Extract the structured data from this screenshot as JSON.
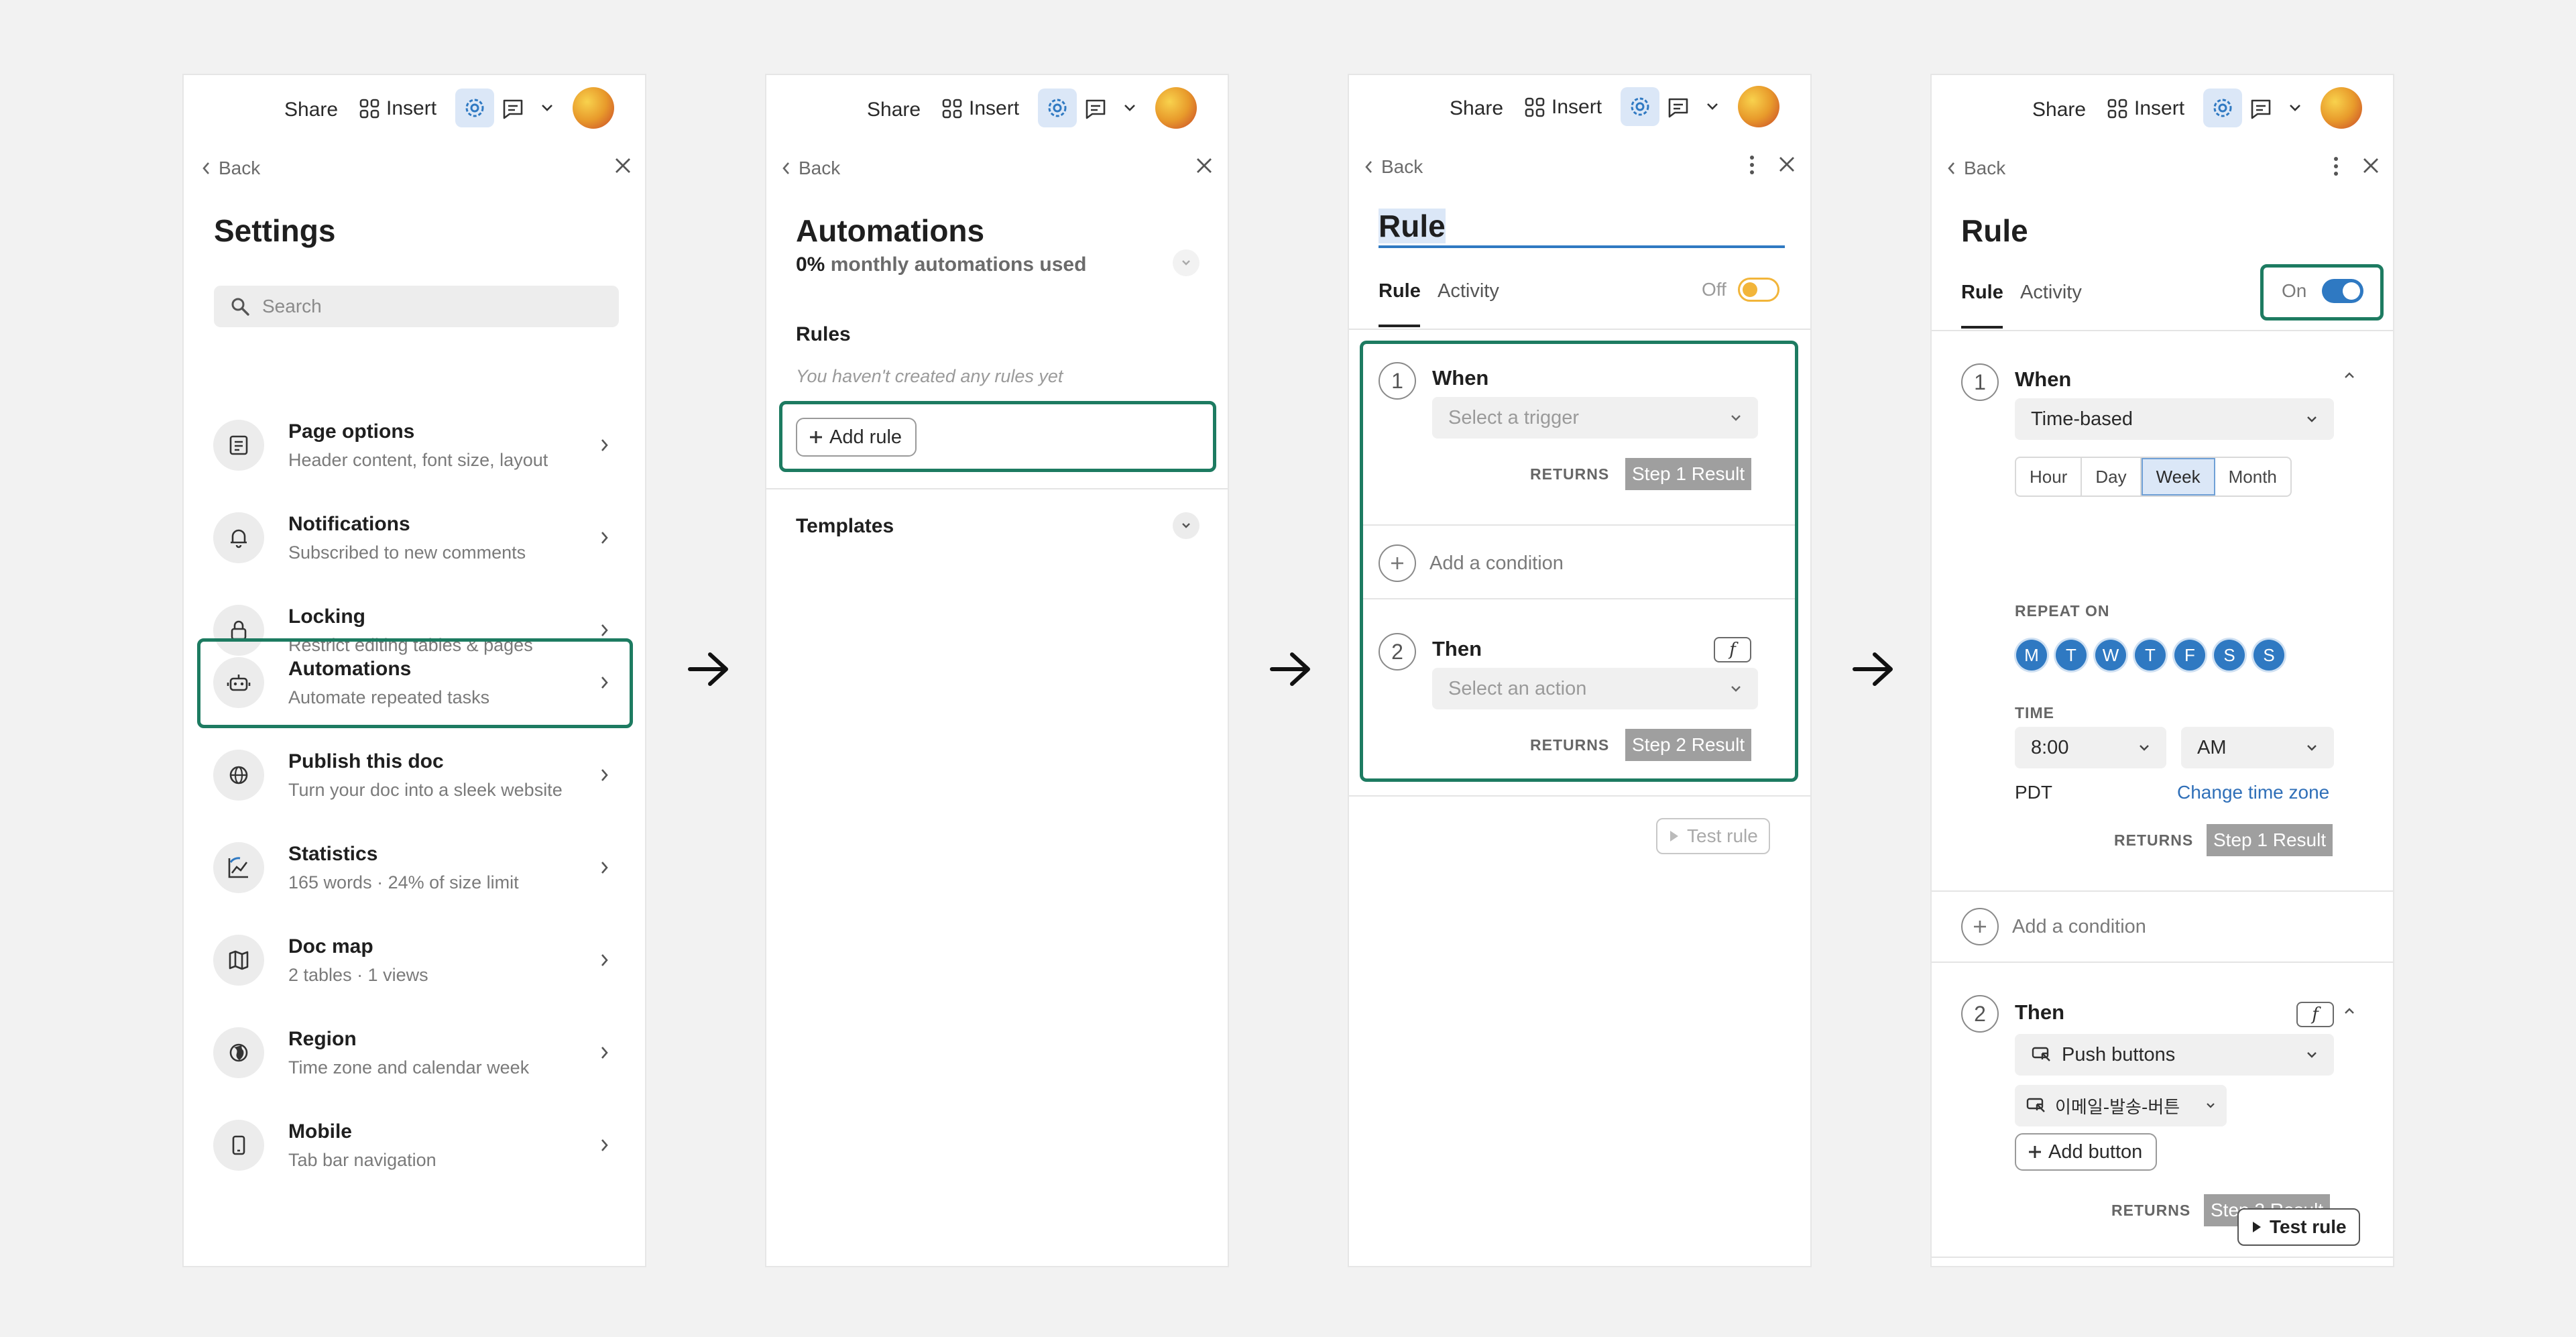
{
  "topbar": {
    "share": "Share",
    "insert": "Insert"
  },
  "back": "Back",
  "settings": {
    "title": "Settings",
    "search_placeholder": "Search",
    "items": [
      {
        "title": "Page options",
        "subtitle": "Header content, font size, layout",
        "icon": "page-icon"
      },
      {
        "title": "Notifications",
        "subtitle": "Subscribed to new comments",
        "icon": "bell-icon"
      },
      {
        "title": "Locking",
        "subtitle": "Restrict editing tables & pages",
        "icon": "lock-icon"
      },
      {
        "title": "Automations",
        "subtitle": "Automate repeated tasks",
        "icon": "robot-icon"
      },
      {
        "title": "Publish this doc",
        "subtitle": "Turn your doc into a sleek website",
        "icon": "globe-icon"
      },
      {
        "title": "Statistics",
        "subtitle": "165 words · 24% of size limit",
        "icon": "chart-icon"
      },
      {
        "title": "Doc map",
        "subtitle": "2 tables · 1 views",
        "icon": "map-icon"
      },
      {
        "title": "Region",
        "subtitle": "Time zone and calendar week",
        "icon": "region-icon"
      },
      {
        "title": "Mobile",
        "subtitle": "Tab bar navigation",
        "icon": "mobile-icon"
      }
    ]
  },
  "automations": {
    "title": "Automations",
    "usage_pct": "0%",
    "usage_label": "monthly automations used",
    "rules_label": "Rules",
    "empty": "You haven't created any rules yet",
    "add_rule": "Add rule",
    "templates": "Templates"
  },
  "rule": {
    "title": "Rule",
    "tab_rule": "Rule",
    "tab_activity": "Activity",
    "off": "Off",
    "on": "On",
    "when": "When",
    "then": "Then",
    "trigger_placeholder": "Select a trigger",
    "action_placeholder": "Select an action",
    "returns": "RETURNS",
    "step1_result": "Step 1 Result",
    "step2_result": "Step 2 Result",
    "add_condition": "Add a condition",
    "test_rule": "Test rule",
    "step1": "1",
    "step2": "2",
    "f": "f"
  },
  "rule_on": {
    "trigger": "Time-based",
    "periods": [
      "Hour",
      "Day",
      "Week",
      "Month"
    ],
    "repeat_on": "REPEAT ON",
    "days": [
      "M",
      "T",
      "W",
      "T",
      "F",
      "S",
      "S"
    ],
    "time_label": "TIME",
    "time": "8:00",
    "ampm": "AM",
    "tz": "PDT",
    "change_tz": "Change time zone",
    "action": "Push buttons",
    "button_name": "이메일-발송-버튼",
    "add_button": "Add button"
  },
  "colors": {
    "accent": "#1d7b61",
    "blue": "#2f79c2",
    "toggle_off": "#f2b53a"
  }
}
